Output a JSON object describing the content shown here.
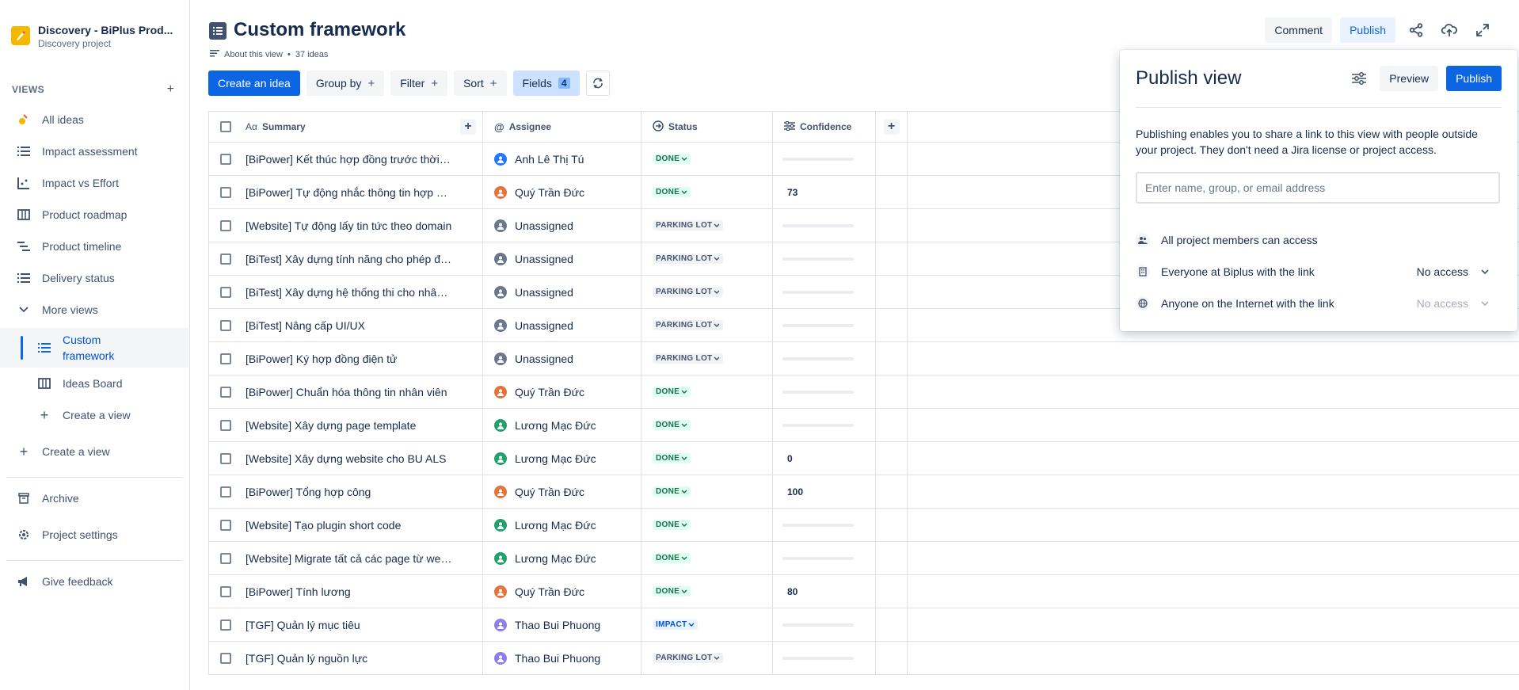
{
  "project": {
    "name": "Discovery - BiPlus Prod...",
    "type": "Discovery project"
  },
  "sidebar": {
    "views_label": "VIEWS",
    "items": [
      {
        "label": "All ideas"
      },
      {
        "label": "Impact assessment"
      },
      {
        "label": "Impact vs Effort"
      },
      {
        "label": "Product roadmap"
      },
      {
        "label": "Product timeline"
      },
      {
        "label": "Delivery status"
      },
      {
        "label": "More views"
      },
      {
        "label": "Custom framework"
      },
      {
        "label": "Ideas Board"
      },
      {
        "label": "Create a view"
      },
      {
        "label": "Create a view"
      },
      {
        "label": "Archive"
      },
      {
        "label": "Project settings"
      },
      {
        "label": "Give feedback"
      }
    ]
  },
  "header": {
    "title": "Custom framework",
    "about": "About this view",
    "count": "37 ideas",
    "comment": "Comment",
    "publish": "Publish"
  },
  "toolbar": {
    "create": "Create an idea",
    "group_by": "Group by",
    "filter": "Filter",
    "sort": "Sort",
    "fields": "Fields",
    "fields_count": "4"
  },
  "table": {
    "columns": {
      "summary": "Summary",
      "assignee": "Assignee",
      "status": "Status",
      "confidence": "Confidence"
    },
    "rows": [
      {
        "summary": "[BiPower] Kết thúc hợp đồng trước thời hạn",
        "assignee": "Anh Lê Thị Tú",
        "avatar": "at",
        "status": "DONE",
        "confidence": ""
      },
      {
        "summary": "[BiPower] Tự động nhắc thông tin hợp đồng",
        "assignee": "Quý Trần Đức",
        "avatar": "q",
        "status": "DONE",
        "confidence": "73"
      },
      {
        "summary": "[Website] Tự động lấy tin tức theo domain",
        "assignee": "Unassigned",
        "avatar": "u",
        "status": "PARKING LOT",
        "confidence": ""
      },
      {
        "summary": "[BiTest] Xây dựng tính năng cho phép đánh giá",
        "assignee": "Unassigned",
        "avatar": "u",
        "status": "PARKING LOT",
        "confidence": ""
      },
      {
        "summary": "[BiTest] Xây dựng hệ thống thi cho nhân viên",
        "assignee": "Unassigned",
        "avatar": "u",
        "status": "PARKING LOT",
        "confidence": ""
      },
      {
        "summary": "[BiTest] Nâng cấp UI/UX",
        "assignee": "Unassigned",
        "avatar": "u",
        "status": "PARKING LOT",
        "confidence": ""
      },
      {
        "summary": "[BiPower] Ký hợp đồng điện tử",
        "assignee": "Unassigned",
        "avatar": "u",
        "status": "PARKING LOT",
        "confidence": ""
      },
      {
        "summary": "[BiPower] Chuẩn hóa thông tin nhân viên",
        "assignee": "Quý Trần Đức",
        "avatar": "q",
        "status": "DONE",
        "confidence": ""
      },
      {
        "summary": "[Website] Xây dựng page template",
        "assignee": "Lương Mạc Đức",
        "avatar": "l",
        "status": "DONE",
        "confidence": ""
      },
      {
        "summary": "[Website] Xây dựng website cho BU ALS",
        "assignee": "Lương Mạc Đức",
        "avatar": "l",
        "status": "DONE",
        "confidence": "0"
      },
      {
        "summary": "[BiPower] Tổng hợp công",
        "assignee": "Quý Trần Đức",
        "avatar": "q",
        "status": "DONE",
        "confidence": "100"
      },
      {
        "summary": "[Website] Tạo plugin short code",
        "assignee": "Lương Mạc Đức",
        "avatar": "l",
        "status": "DONE",
        "confidence": ""
      },
      {
        "summary": "[Website] Migrate tất cả các page từ website cũ",
        "assignee": "Lương Mạc Đức",
        "avatar": "l",
        "status": "DONE",
        "confidence": ""
      },
      {
        "summary": "[BiPower] Tính lương",
        "assignee": "Quý Trần Đức",
        "avatar": "q",
        "status": "DONE",
        "confidence": "80"
      },
      {
        "summary": "[TGF] Quản lý mục tiêu",
        "assignee": "Thao Bui Phuong",
        "avatar": "t",
        "status": "IMPACT",
        "confidence": ""
      },
      {
        "summary": "[TGF] Quản lý nguồn lực",
        "assignee": "Thao Bui Phuong",
        "avatar": "t",
        "status": "PARKING LOT",
        "confidence": ""
      }
    ]
  },
  "publish_panel": {
    "title": "Publish view",
    "preview": "Preview",
    "publish": "Publish",
    "description": "Publishing enables you to share a link to this view with people outside your project. They don't need a Jira license or project access.",
    "input_placeholder": "Enter name, group, or email address",
    "access": [
      {
        "label": "All project members can access",
        "value": ""
      },
      {
        "label": "Everyone at Biplus with the link",
        "value": "No access"
      },
      {
        "label": "Anyone on the Internet with the link",
        "value": "No access"
      }
    ]
  },
  "colors": {
    "primary": "#0c66e4",
    "done": "#216e4e",
    "impact": "#0055cc"
  }
}
